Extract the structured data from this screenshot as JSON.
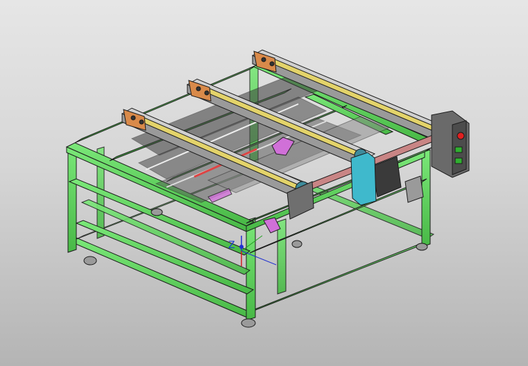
{
  "viewport": {
    "background_top": "#e6e6e6",
    "background_bottom": "#b4b4b4"
  },
  "model": {
    "frame_color": "#5cd65a",
    "frame_edge_color": "#1b1b1b",
    "rail_color": "#c9c9c9",
    "belt_color": "#e3d36a",
    "end_plate_color": "#d98a4a",
    "shaft_color": "#c98585",
    "drive_cover_color": "#3fb9cc",
    "control_box_color": "#6a6a6a"
  },
  "triad": {
    "z_label": "Z",
    "x_color": "#d02020",
    "y_color": "#20a020",
    "z_color": "#2030d0"
  }
}
